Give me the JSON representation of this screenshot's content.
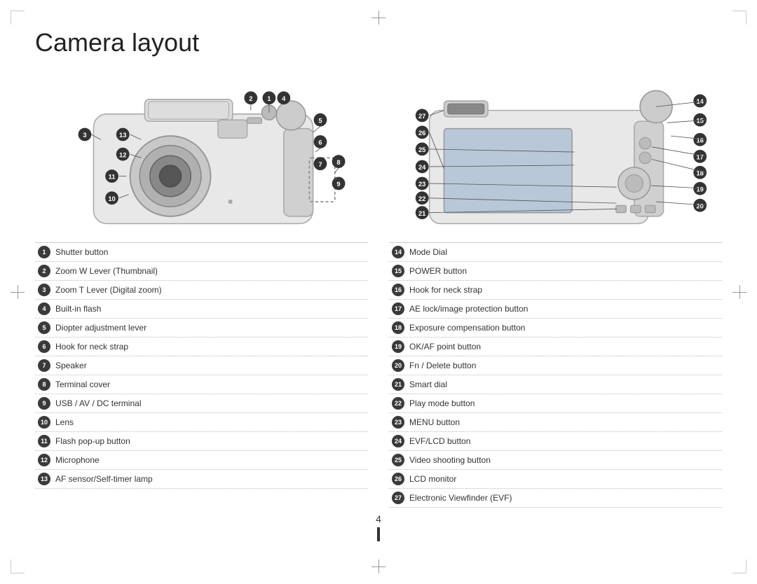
{
  "title": "Camera layout",
  "page_number": "4",
  "left_items": [
    {
      "num": "1",
      "label": "Shutter button"
    },
    {
      "num": "2",
      "label": "Zoom W Lever (Thumbnail)"
    },
    {
      "num": "3",
      "label": "Zoom T Lever (Digital zoom)"
    },
    {
      "num": "4",
      "label": "Built-in flash"
    },
    {
      "num": "5",
      "label": "Diopter adjustment lever"
    },
    {
      "num": "6",
      "label": "Hook for neck strap"
    },
    {
      "num": "7",
      "label": "Speaker"
    },
    {
      "num": "8",
      "label": "Terminal cover"
    },
    {
      "num": "9",
      "label": "USB / AV / DC terminal"
    },
    {
      "num": "10",
      "label": "Lens"
    },
    {
      "num": "11",
      "label": "Flash pop-up button"
    },
    {
      "num": "12",
      "label": "Microphone"
    },
    {
      "num": "13",
      "label": "AF sensor/Self-timer lamp"
    }
  ],
  "right_items": [
    {
      "num": "14",
      "label": "Mode Dial"
    },
    {
      "num": "15",
      "label": "POWER button"
    },
    {
      "num": "16",
      "label": "Hook for neck strap"
    },
    {
      "num": "17",
      "label": "AE lock/image protection button"
    },
    {
      "num": "18",
      "label": "Exposure compensation button"
    },
    {
      "num": "19",
      "label": "OK/AF point button"
    },
    {
      "num": "20",
      "label": "Fn / Delete button"
    },
    {
      "num": "21",
      "label": "Smart dial"
    },
    {
      "num": "22",
      "label": "Play mode button"
    },
    {
      "num": "23",
      "label": "MENU button"
    },
    {
      "num": "24",
      "label": "EVF/LCD button"
    },
    {
      "num": "25",
      "label": "Video shooting button"
    },
    {
      "num": "26",
      "label": "LCD monitor"
    },
    {
      "num": "27",
      "label": "Electronic Viewfinder (EVF)"
    }
  ]
}
